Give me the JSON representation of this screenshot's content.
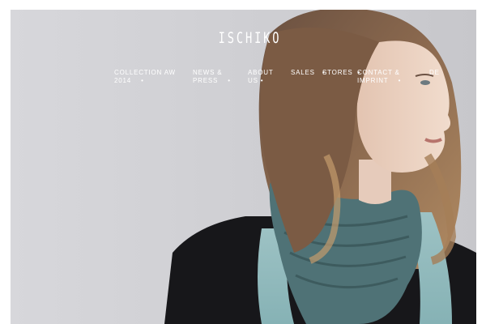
{
  "brand": {
    "logo_text": "ISCHIKO"
  },
  "nav": {
    "collection": {
      "line1": "COLLECTION AW",
      "line2": "2014",
      "dot": "•"
    },
    "news": {
      "line1": "NEWS &",
      "line2": "PRESS",
      "dot": "•"
    },
    "about": {
      "line1": "ABOUT",
      "line2": "US",
      "dot": "•"
    },
    "sales": {
      "line1": "SALES",
      "dot": "•"
    },
    "stores": {
      "line1": "STORES",
      "dot": "•"
    },
    "contact": {
      "line1": "CONTACT &",
      "line2": "IMPRINT",
      "dot": "•"
    },
    "language": {
      "line1": "DE"
    }
  },
  "colors": {
    "background": "#d4d4d8",
    "nav_text": "#ffffff"
  },
  "hero": {
    "image_description": "portrait-woman-scarf"
  }
}
